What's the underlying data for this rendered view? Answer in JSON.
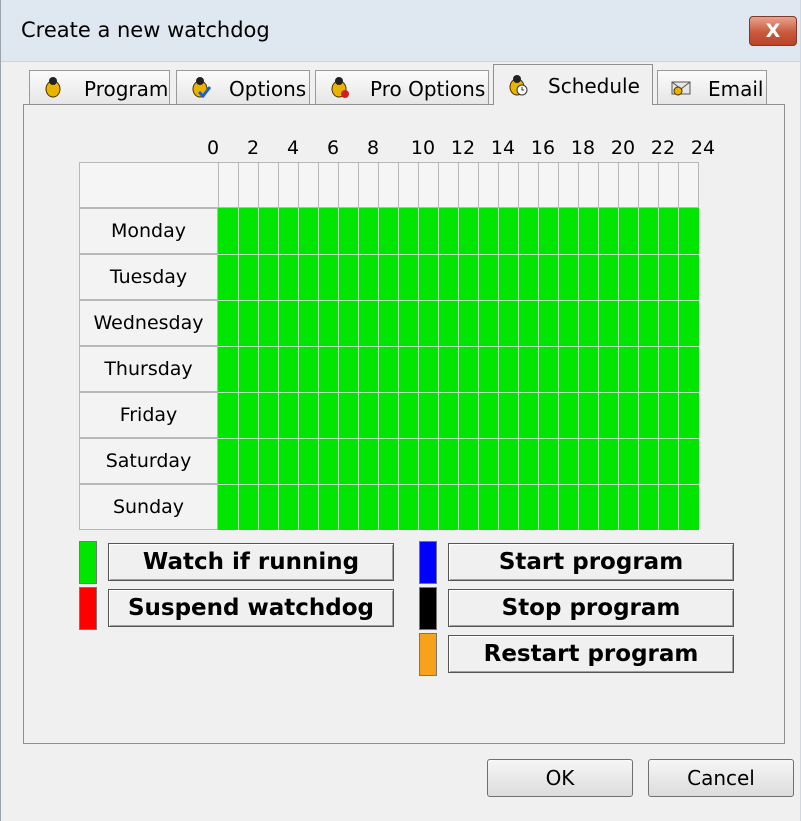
{
  "window": {
    "title": "Create a new watchdog",
    "close_label": "X"
  },
  "tabs": [
    {
      "label": "Program",
      "icon": "bug-icon"
    },
    {
      "label": "Options",
      "icon": "bug-check-icon"
    },
    {
      "label": "Pro Options",
      "icon": "bug-star-icon"
    },
    {
      "label": "Schedule",
      "icon": "bug-clock-icon"
    },
    {
      "label": "Email",
      "icon": "email-icon"
    }
  ],
  "active_tab": "Schedule",
  "schedule": {
    "hour_labels": [
      "0",
      "2",
      "4",
      "6",
      "8",
      "10",
      "12",
      "14",
      "16",
      "18",
      "20",
      "22",
      "24"
    ],
    "days": [
      "Monday",
      "Tuesday",
      "Wednesday",
      "Thursday",
      "Friday",
      "Saturday",
      "Sunday"
    ],
    "fill_color": "#00e600",
    "state": "Watch if running"
  },
  "legend": {
    "watch": {
      "label": "Watch if running",
      "color": "#00e600"
    },
    "suspend": {
      "label": "Suspend watchdog",
      "color": "#ff0000"
    },
    "start": {
      "label": "Start program",
      "color": "#0000ff"
    },
    "stop": {
      "label": "Stop program",
      "color": "#000000"
    },
    "restart": {
      "label": "Restart program",
      "color": "#f8a21c"
    }
  },
  "buttons": {
    "ok": "OK",
    "cancel": "Cancel"
  }
}
